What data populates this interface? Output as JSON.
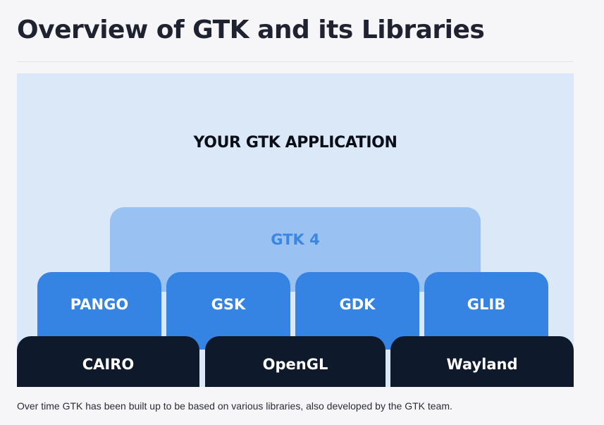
{
  "page": {
    "title": "Overview of GTK and its Libraries",
    "caption": "Over time GTK has been built up to be based on various libraries, also developed by the GTK team."
  },
  "diagram": {
    "application_label": "YOUR GTK APPLICATION",
    "toolkit_label": "GTK 4",
    "libraries": [
      "PANGO",
      "GSK",
      "GDK",
      "GLIB"
    ],
    "backends": [
      "CAIRO",
      "OpenGL",
      "Wayland"
    ],
    "colors": {
      "background": "#dbe8f8",
      "toolkit_fill": "#99c1f1",
      "toolkit_text": "#3a86e2",
      "library_fill": "#3584e4",
      "backend_fill": "#0e1a2b"
    }
  }
}
